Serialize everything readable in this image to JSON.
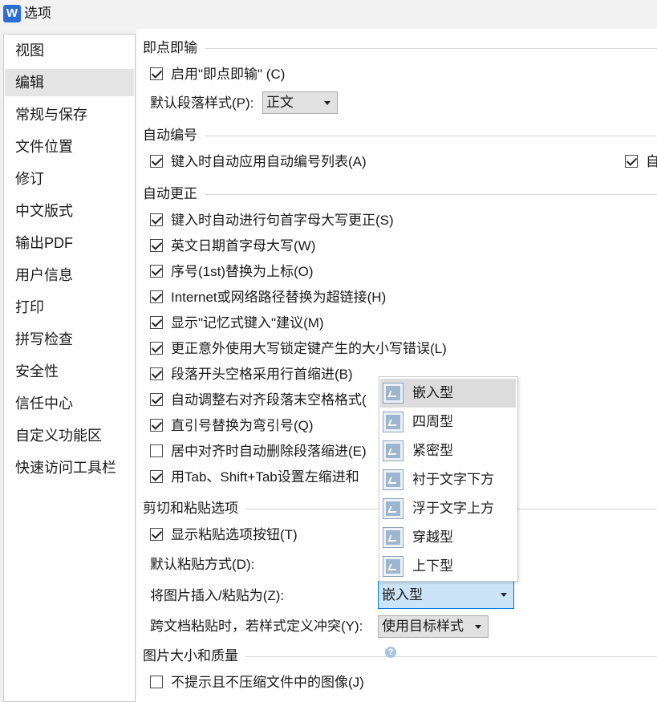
{
  "window": {
    "title": "选项",
    "app_icon_letter": "W"
  },
  "sidebar": {
    "items": [
      "视图",
      "编辑",
      "常规与保存",
      "文件位置",
      "修订",
      "中文版式",
      "输出PDF",
      "用户信息",
      "打印",
      "拼写检查",
      "安全性",
      "信任中心",
      "自定义功能区",
      "快速访问工具栏"
    ],
    "selected": "编辑"
  },
  "click_and_type": {
    "header": "即点即输",
    "enable": {
      "label": "启用\"即点即输\" (C)",
      "checked": true
    },
    "default_style_label": "默认段落样式(P):",
    "default_style_value": "正文"
  },
  "auto_numbering": {
    "header": "自动编号",
    "apply_list": {
      "label": "键入时自动应用自动编号列表(A)",
      "checked": true
    },
    "right_option": {
      "label": "自",
      "checked": true
    }
  },
  "auto_correct": {
    "header": "自动更正",
    "items": [
      {
        "label": "键入时自动进行句首字母大写更正(S)",
        "checked": true
      },
      {
        "label": "英文日期首字母大写(W)",
        "checked": true
      },
      {
        "label": "序号(1st)替换为上标(O)",
        "checked": true
      },
      {
        "label": "Internet或网络路径替换为超链接(H)",
        "checked": true
      },
      {
        "label": "显示\"记忆式键入\"建议(M)",
        "checked": true
      },
      {
        "label": "更正意外使用大写锁定键产生的大小写错误(L)",
        "checked": true
      },
      {
        "label": "段落开头空格采用行首缩进(B)",
        "checked": true
      },
      {
        "label": "自动调整右对齐段落末空格格式(",
        "checked": true
      },
      {
        "label": "直引号替换为弯引号(Q)",
        "checked": true
      },
      {
        "label": "居中对齐时自动删除段落缩进(E)",
        "checked": false
      },
      {
        "label": "用Tab、Shift+Tab设置左缩进和",
        "checked": true
      }
    ]
  },
  "paste": {
    "header": "剪切和粘贴选项",
    "show_button": {
      "label": "显示粘贴选项按钮(T)",
      "checked": true
    },
    "default_paste_label": "默认粘贴方式(D):",
    "insert_image_label": "将图片插入/粘贴为(Z):",
    "insert_image_value": "嵌入型",
    "conflict_label": "跨文档粘贴时，若样式定义冲突(Y):",
    "conflict_value": "使用目标样式"
  },
  "image_quality": {
    "header": "图片大小和质量",
    "no_compress": {
      "label": "不提示且不压缩文件中的图像(J)",
      "checked": false
    },
    "help_glyph": "?"
  },
  "wrap_dropdown": {
    "options": [
      "嵌入型",
      "四周型",
      "紧密型",
      "衬于文字下方",
      "浮于文字上方",
      "穿越型",
      "上下型"
    ],
    "selected": "嵌入型"
  },
  "colors": {
    "accent": "#0078d7",
    "select_active_bg": "#cce4f7",
    "sidebar_selected": "#e4e4e4"
  }
}
